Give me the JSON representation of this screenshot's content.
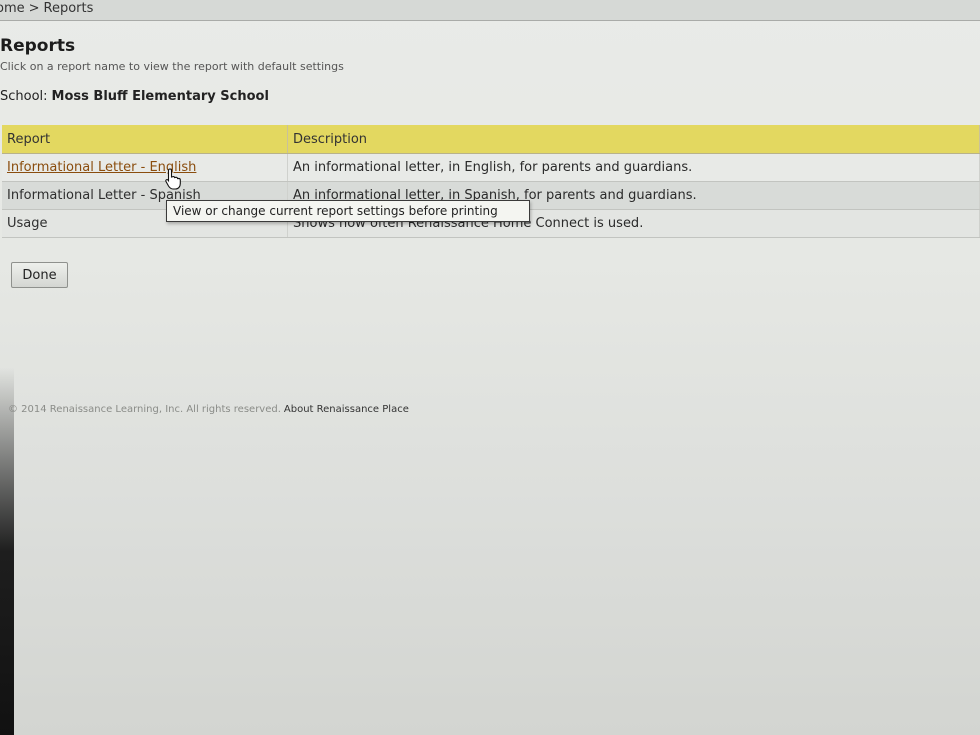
{
  "breadcrumb": {
    "home": "ome",
    "separator": ">",
    "current": "Reports"
  },
  "header": {
    "title": "Reports",
    "subtitle": "Click on a report name to view the report with default settings"
  },
  "school": {
    "label": "School:",
    "name": "Moss Bluff Elementary School"
  },
  "table": {
    "headers": {
      "report": "Report",
      "description": "Description"
    },
    "rows": [
      {
        "name": "Informational Letter - English",
        "description": "An informational letter, in English, for parents and guardians."
      },
      {
        "name": "Informational Letter - Spanish",
        "description": "An informational letter, in Spanish, for parents and guardians."
      },
      {
        "name": "Usage",
        "description": "Shows how often Renaissance Home Connect is used."
      }
    ]
  },
  "tooltip": {
    "text": "View or change current report settings before printing"
  },
  "actions": {
    "done_label": "Done"
  },
  "footer": {
    "copyright": "© 2014 Renaissance Learning, Inc. All rights reserved.",
    "about_link": "About Renaissance Place"
  },
  "colors": {
    "header_row": "#e3d860",
    "active_link": "#8a4d0e"
  },
  "icons": {
    "cursor": "hand-pointer-icon"
  }
}
